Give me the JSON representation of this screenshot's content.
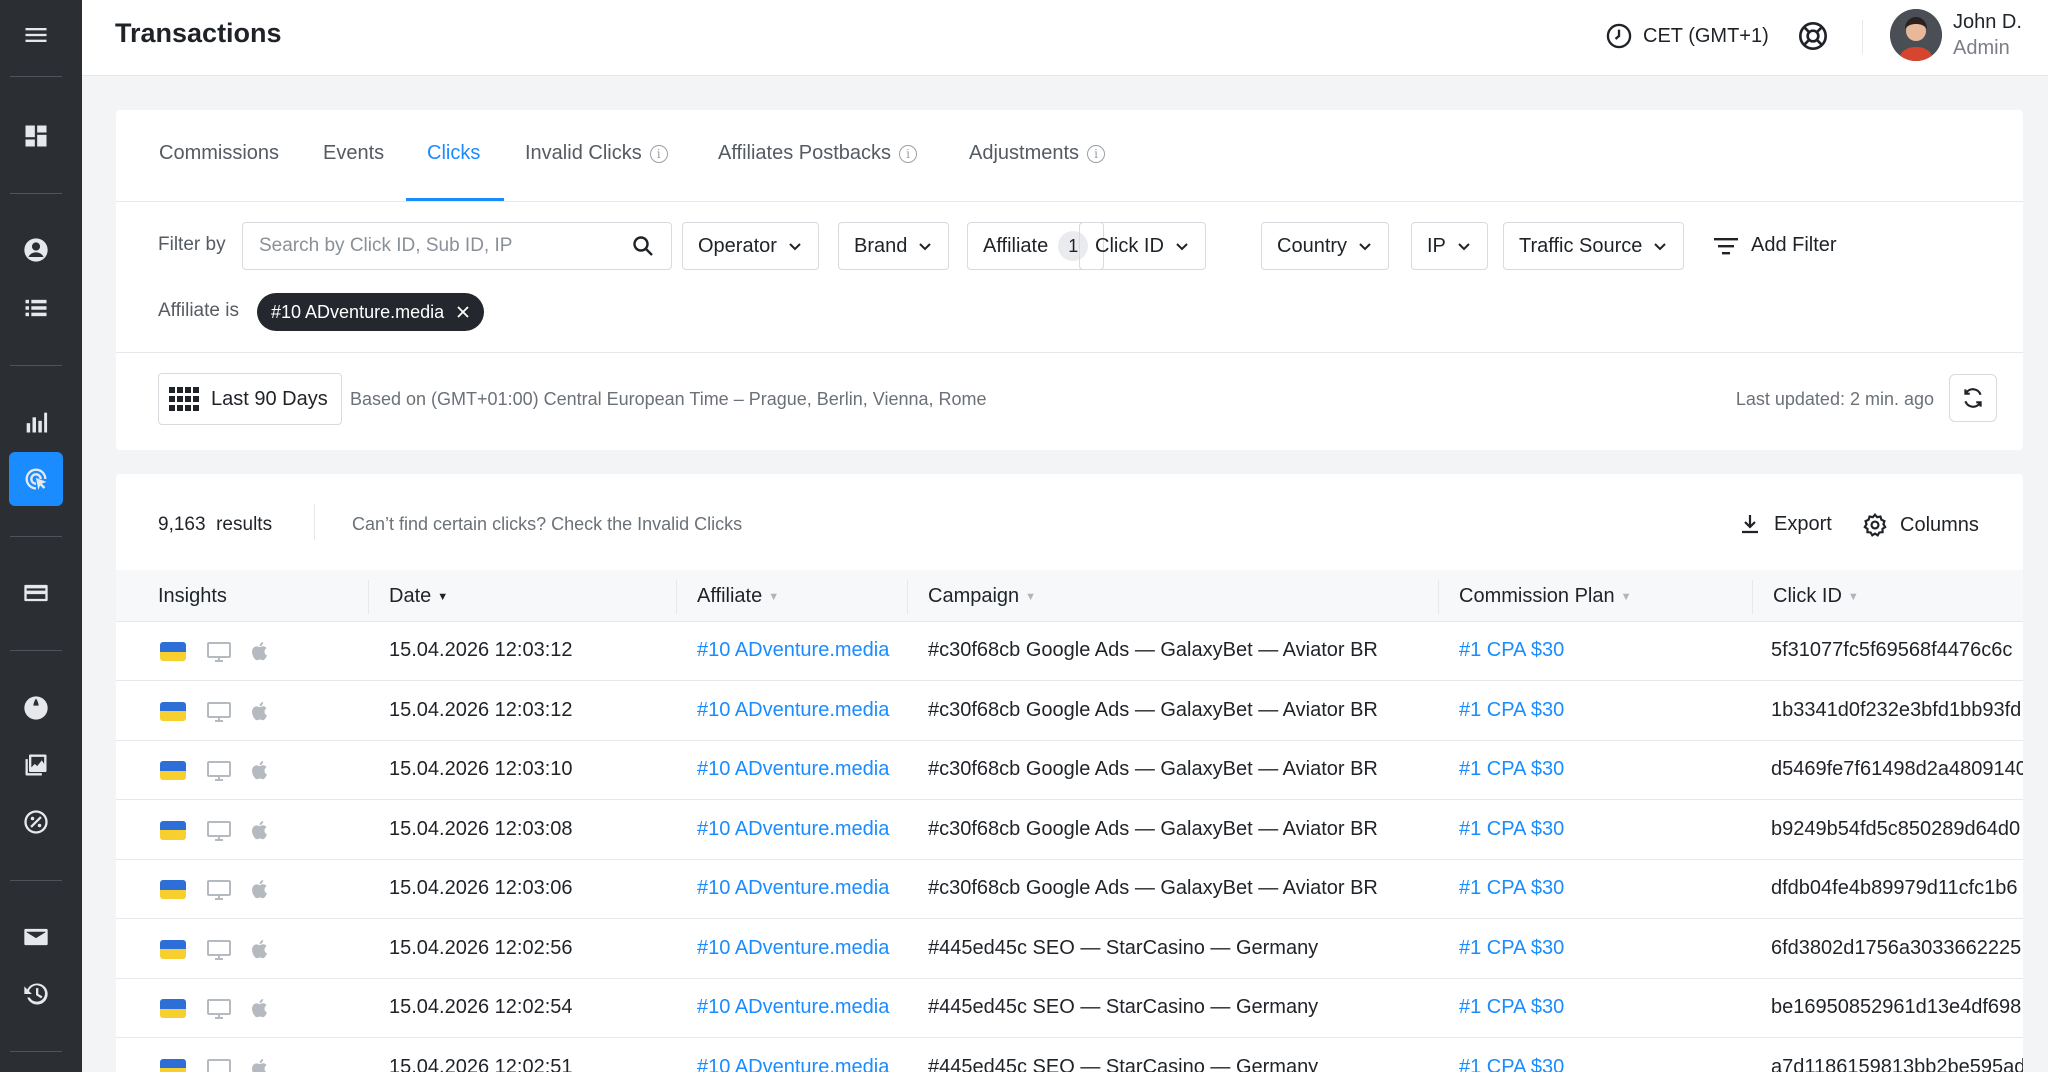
{
  "page": {
    "title": "Transactions"
  },
  "header": {
    "timezone": "CET (GMT+1)",
    "user_name": "John D.",
    "user_role": "Admin"
  },
  "colors": {
    "accent": "#1a8cff",
    "sidebar": "#2b2e33",
    "chip": "#24282e"
  },
  "sidebar": {
    "items": [
      {
        "icon": "menu-icon"
      },
      {
        "icon": "dashboard-icon"
      },
      {
        "icon": "user-icon"
      },
      {
        "icon": "list-icon"
      },
      {
        "icon": "bar-chart-icon"
      },
      {
        "icon": "click-target-icon",
        "active": true
      },
      {
        "icon": "card-icon"
      },
      {
        "icon": "globe-icon"
      },
      {
        "icon": "images-icon"
      },
      {
        "icon": "percent-icon"
      },
      {
        "icon": "mail-icon"
      },
      {
        "icon": "history-icon"
      }
    ]
  },
  "tabs": [
    {
      "label": "Commissions"
    },
    {
      "label": "Events"
    },
    {
      "label": "Clicks",
      "active": true
    },
    {
      "label": "Invalid Clicks",
      "info": true
    },
    {
      "label": "Affiliates Postbacks",
      "info": true
    },
    {
      "label": "Adjustments",
      "info": true
    }
  ],
  "filters": {
    "label": "Filter by",
    "search_placeholder": "Search by Click ID, Sub ID, IP",
    "operator": "Operator",
    "brand": "Brand",
    "affiliate": "Affiliate",
    "affiliate_count": "1",
    "click_id": "Click ID",
    "country": "Country",
    "ip": "IP",
    "traffic_source": "Traffic Source",
    "add_filter": "Add Filter",
    "active_label": "Affiliate is",
    "active_chip": "#10 ADventure.media"
  },
  "date": {
    "range": "Last 90 Days",
    "tz_note": "Based on (GMT+01:00) Central European Time – Prague, Berlin, Vienna, Rome",
    "last_updated": "Last updated: 2 min. ago"
  },
  "results": {
    "count": "9,163",
    "count_label": "results",
    "note": "Can’t find certain clicks? Check the Invalid Clicks",
    "export": "Export",
    "columns": "Columns"
  },
  "table": {
    "headers": {
      "insights": "Insights",
      "date": "Date",
      "affiliate": "Affiliate",
      "campaign": "Campaign",
      "plan": "Commission Plan",
      "click_id": "Click ID"
    },
    "rows": [
      {
        "date": "15.04.2026 12:03:12",
        "affiliate": "#10 ADventure.media",
        "campaign": "#c30f68cb Google Ads — GalaxyBet — Aviator BR",
        "plan": "#1 CPA $30",
        "click_id": "5f31077fc5f69568f4476c6c"
      },
      {
        "date": "15.04.2026 12:03:12",
        "affiliate": "#10 ADventure.media",
        "campaign": "#c30f68cb Google Ads — GalaxyBet — Aviator BR",
        "plan": "#1 CPA $30",
        "click_id": "1b3341d0f232e3bfd1bb93fd"
      },
      {
        "date": "15.04.2026 12:03:10",
        "affiliate": "#10 ADventure.media",
        "campaign": "#c30f68cb Google Ads — GalaxyBet — Aviator BR",
        "plan": "#1 CPA $30",
        "click_id": "d5469fe7f61498d2a4809140"
      },
      {
        "date": "15.04.2026 12:03:08",
        "affiliate": "#10 ADventure.media",
        "campaign": "#c30f68cb Google Ads — GalaxyBet — Aviator BR",
        "plan": "#1 CPA $30",
        "click_id": "b9249b54fd5c850289d64d0"
      },
      {
        "date": "15.04.2026 12:03:06",
        "affiliate": "#10 ADventure.media",
        "campaign": "#c30f68cb Google Ads — GalaxyBet — Aviator BR",
        "plan": "#1 CPA $30",
        "click_id": "dfdb04fe4b89979d11cfc1b6"
      },
      {
        "date": "15.04.2026 12:02:56",
        "affiliate": "#10 ADventure.media",
        "campaign": "#445ed45c SEO — StarCasino — Germany",
        "plan": "#1 CPA $30",
        "click_id": "6fd3802d1756a3033662225"
      },
      {
        "date": "15.04.2026 12:02:54",
        "affiliate": "#10 ADventure.media",
        "campaign": "#445ed45c SEO — StarCasino — Germany",
        "plan": "#1 CPA $30",
        "click_id": "be16950852961d13e4df698"
      },
      {
        "date": "15.04.2026 12:02:51",
        "affiliate": "#10 ADventure.media",
        "campaign": "#445ed45c SEO — StarCasino — Germany",
        "plan": "#1 CPA $30",
        "click_id": "a7d1186159813bb2be595ad"
      }
    ]
  }
}
